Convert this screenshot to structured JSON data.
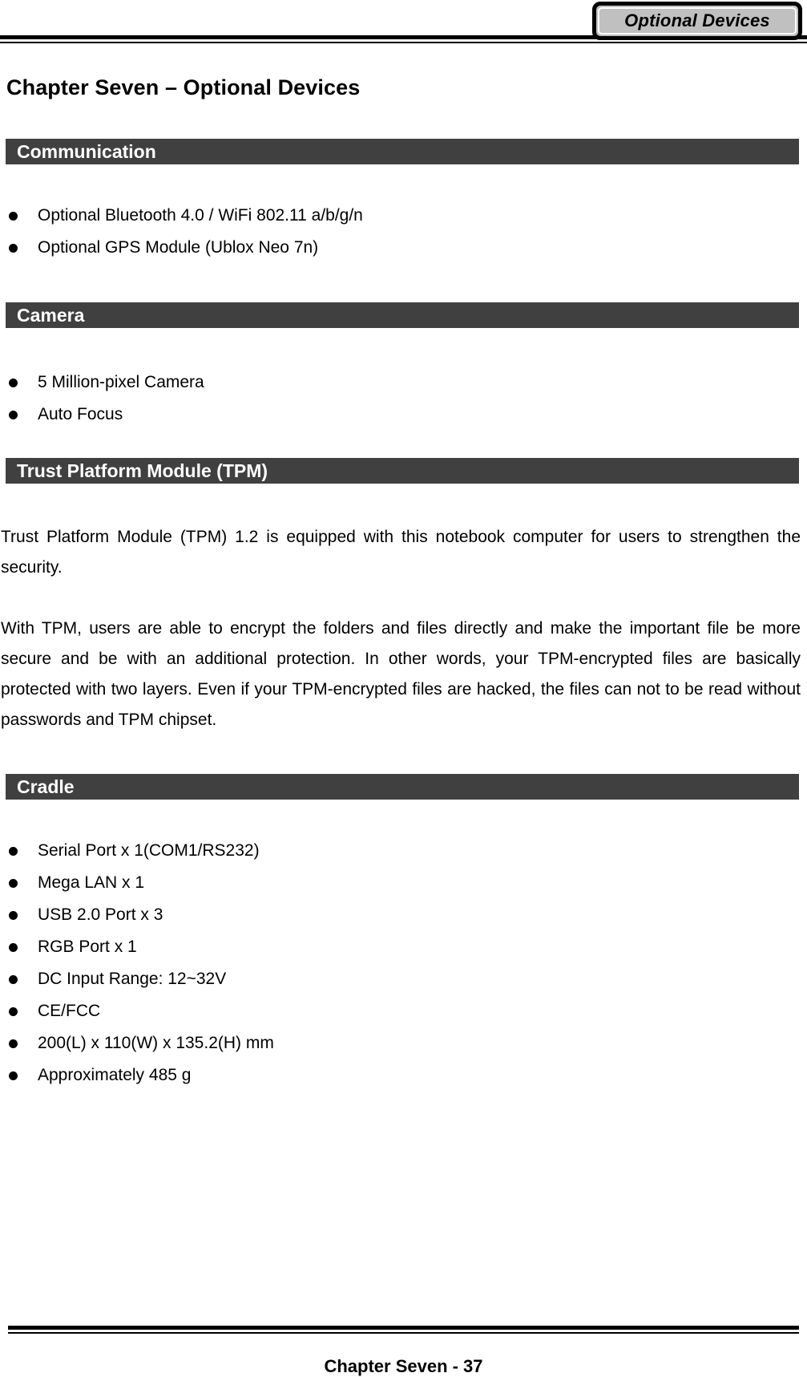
{
  "header": {
    "tab_label": "Optional Devices"
  },
  "chapter_title": "Chapter Seven – Optional Devices",
  "sections": [
    {
      "id": "communication",
      "heading": "Communication",
      "bullets": [
        "Optional Bluetooth 4.0 / WiFi 802.11 a/b/g/n",
        "Optional GPS Module (Ublox Neo 7n)"
      ]
    },
    {
      "id": "camera",
      "heading": "Camera",
      "bullets": [
        "5 Million-pixel Camera",
        "Auto Focus"
      ]
    },
    {
      "id": "tpm",
      "heading": "Trust Platform Module (TPM)",
      "paragraphs": [
        "Trust Platform Module (TPM) 1.2 is equipped with this notebook computer for users to strengthen the security.",
        "With TPM, users are able to encrypt the folders and files directly and make the important file be more secure and be with an additional protection. In other words, your TPM-encrypted files are basically protected with two layers. Even if your TPM-encrypted files are hacked, the files can not to be read without passwords and TPM chipset."
      ]
    },
    {
      "id": "cradle",
      "heading": "Cradle",
      "bullets": [
        "Serial Port x 1(COM1/RS232)",
        "Mega LAN x 1",
        "USB 2.0 Port x 3",
        "RGB Port x 1",
        "DC Input Range: 12~32V",
        "CE/FCC",
        "200(L) x 110(W) x 135.2(H) mm",
        "Approximately 485 g"
      ]
    }
  ],
  "footer": {
    "page_label": "Chapter Seven - 37"
  },
  "colors": {
    "section_bar_bg": "#404040",
    "section_bar_text": "#ffffff",
    "tab_fill": "#c0c0c0",
    "rule": "#000000"
  }
}
